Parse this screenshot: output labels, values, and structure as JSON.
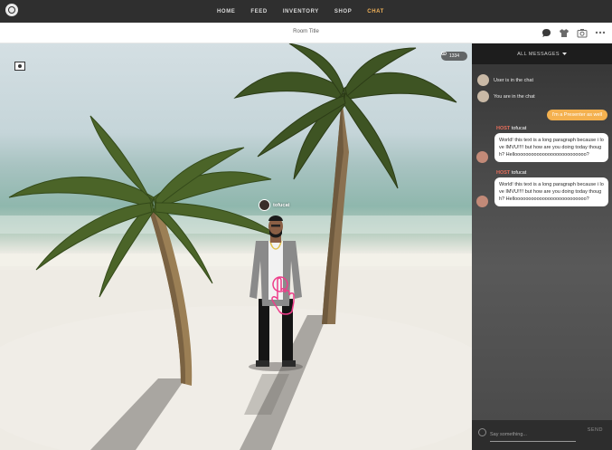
{
  "nav": {
    "items": [
      {
        "label": "HOME",
        "active": false
      },
      {
        "label": "FEED",
        "active": false
      },
      {
        "label": "INVENTORY",
        "active": false
      },
      {
        "label": "SHOP",
        "active": false
      },
      {
        "label": "CHAT",
        "active": true
      }
    ],
    "active_color": "#f2b35a"
  },
  "header": {
    "room_title": "Room Title",
    "icons": [
      "chat-bubble-icon",
      "shirt-icon",
      "camera-icon",
      "more-icon"
    ]
  },
  "scene": {
    "viewer_count": "1334",
    "avatar_name": "tofucat"
  },
  "chat": {
    "filter_label": "ALL MESSAGES",
    "system_messages": [
      {
        "text": "User is in the chat"
      },
      {
        "text": "You are in the chat"
      }
    ],
    "my_message": "I'm a Presenter as well",
    "messages": [
      {
        "tag": "HOST",
        "user": "tofucat",
        "text": "World! this text is a long paragraph because i love IMVU!!!! but how are you doing today though? Helloooooooooooooooooooooooooo?"
      },
      {
        "tag": "HOST",
        "user": "tofucat",
        "text": "World! this text is a long paragraph because i love IMVU!!!! but how are you doing today though? Helloooooooooooooooooooooooooo?"
      }
    ],
    "input_placeholder": "Say something...",
    "send_label": "SEND"
  }
}
